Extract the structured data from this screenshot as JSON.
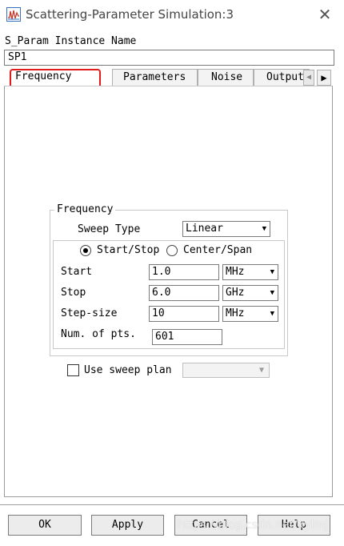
{
  "window": {
    "title": "Scattering-Parameter Simulation:3",
    "close_glyph": "✕"
  },
  "instance": {
    "label": "S_Param Instance Name",
    "value": "SP1"
  },
  "tabs": [
    {
      "label": "Frequency",
      "selected": true
    },
    {
      "label": "Parameters"
    },
    {
      "label": "Noise"
    },
    {
      "label": "Output"
    }
  ],
  "tab_scroll": {
    "prev": "◀",
    "next": "▶"
  },
  "frequency_group": {
    "title": "Frequency",
    "sweep_type_label": "Sweep Type",
    "sweep_type_value": "Linear",
    "mode_start_stop": "Start/Stop",
    "mode_center_span": "Center/Span",
    "selected_mode": "Start/Stop",
    "start_label": "Start",
    "start_value": "1.0",
    "start_unit": "MHz",
    "stop_label": "Stop",
    "stop_value": "6.0",
    "stop_unit": "GHz",
    "step_label": "Step-size",
    "step_value": "10",
    "step_unit": "MHz",
    "pts_label": "Num. of pts.",
    "pts_value": "601"
  },
  "sweep_plan": {
    "label": "Use sweep plan",
    "checked": false,
    "value": ""
  },
  "buttons": {
    "ok": "OK",
    "apply": "Apply",
    "cancel": "Cancel",
    "help": "Help"
  },
  "watermark": "https://blog.csdn.net/xylmj",
  "colors": {
    "tab_highlight": "#e21b1b",
    "icon_accent": "#3a6fbf"
  },
  "icons": {
    "app": "waveform-icon",
    "dropdown": "chevron-down-icon"
  }
}
